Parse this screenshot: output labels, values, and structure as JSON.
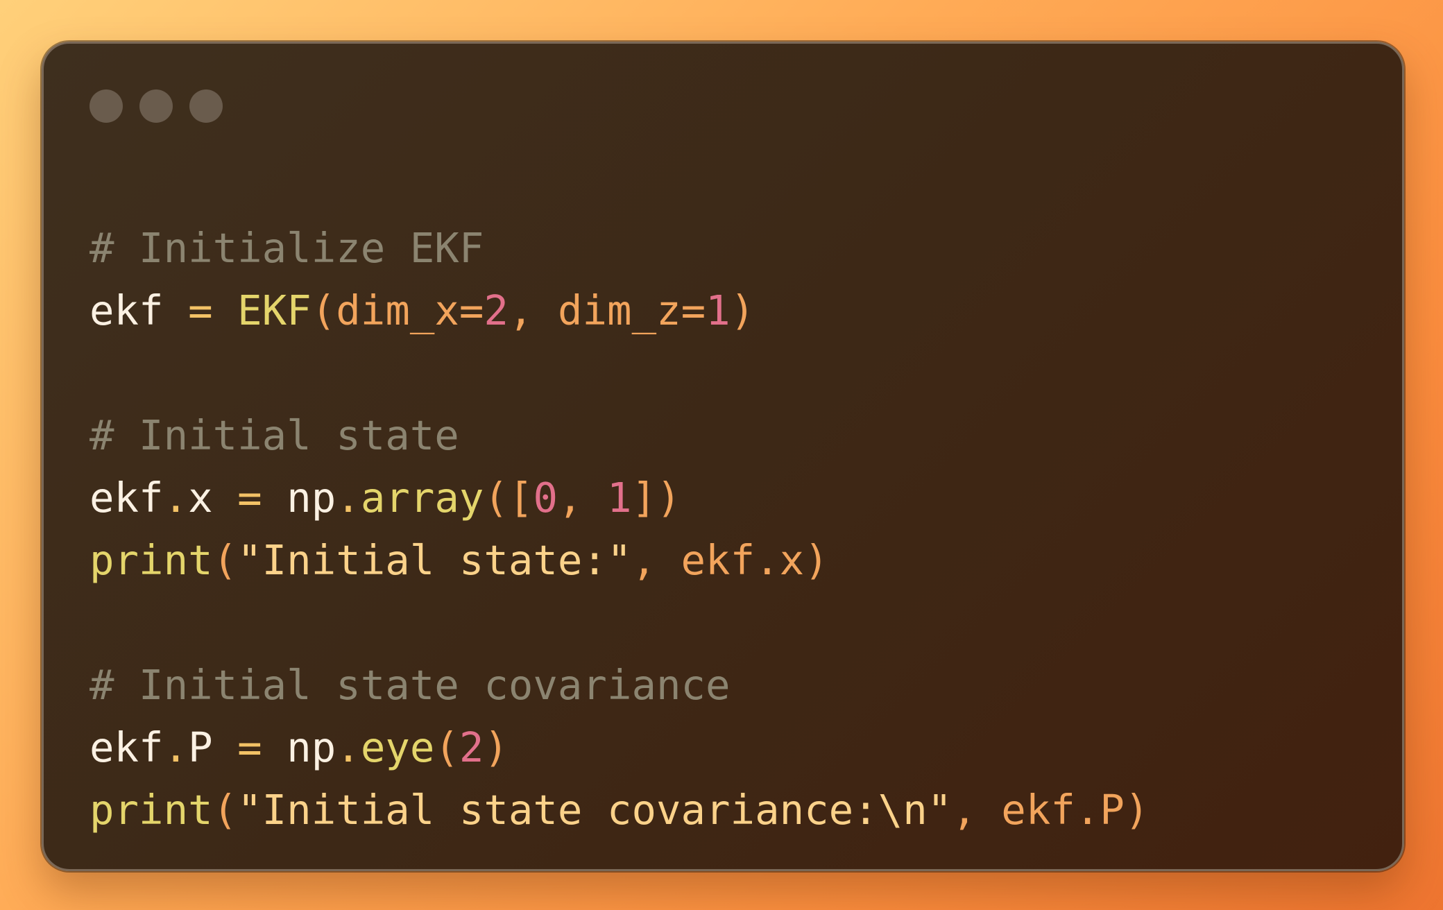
{
  "window": {
    "traffic_lights": [
      "dot",
      "dot",
      "dot"
    ]
  },
  "code_lines": [
    [
      {
        "t": "# Initialize EKF",
        "c": "com"
      }
    ],
    [
      {
        "t": "ekf",
        "c": "var"
      },
      {
        "t": " ",
        "c": "var"
      },
      {
        "t": "=",
        "c": "op"
      },
      {
        "t": " ",
        "c": "var"
      },
      {
        "t": "EKF",
        "c": "fn"
      },
      {
        "t": "(",
        "c": "par"
      },
      {
        "t": "dim_x",
        "c": "par"
      },
      {
        "t": "=",
        "c": "par"
      },
      {
        "t": "2",
        "c": "num"
      },
      {
        "t": ", ",
        "c": "par"
      },
      {
        "t": "dim_z",
        "c": "par"
      },
      {
        "t": "=",
        "c": "par"
      },
      {
        "t": "1",
        "c": "num"
      },
      {
        "t": ")",
        "c": "par"
      }
    ],
    [],
    [
      {
        "t": "# Initial state",
        "c": "com"
      }
    ],
    [
      {
        "t": "ekf",
        "c": "var"
      },
      {
        "t": ".",
        "c": "op"
      },
      {
        "t": "x",
        "c": "var"
      },
      {
        "t": " ",
        "c": "var"
      },
      {
        "t": "=",
        "c": "op"
      },
      {
        "t": " ",
        "c": "var"
      },
      {
        "t": "np",
        "c": "var"
      },
      {
        "t": ".",
        "c": "op"
      },
      {
        "t": "array",
        "c": "fn"
      },
      {
        "t": "([",
        "c": "par"
      },
      {
        "t": "0",
        "c": "num"
      },
      {
        "t": ", ",
        "c": "par"
      },
      {
        "t": "1",
        "c": "num"
      },
      {
        "t": "])",
        "c": "par"
      }
    ],
    [
      {
        "t": "print",
        "c": "fn"
      },
      {
        "t": "(",
        "c": "par"
      },
      {
        "t": "\"Initial state:\"",
        "c": "str"
      },
      {
        "t": ", ",
        "c": "par"
      },
      {
        "t": "ekf",
        "c": "par"
      },
      {
        "t": ".",
        "c": "par"
      },
      {
        "t": "x",
        "c": "par"
      },
      {
        "t": ")",
        "c": "par"
      }
    ],
    [],
    [
      {
        "t": "# Initial state covariance",
        "c": "com"
      }
    ],
    [
      {
        "t": "ekf",
        "c": "var"
      },
      {
        "t": ".",
        "c": "op"
      },
      {
        "t": "P",
        "c": "var"
      },
      {
        "t": " ",
        "c": "var"
      },
      {
        "t": "=",
        "c": "op"
      },
      {
        "t": " ",
        "c": "var"
      },
      {
        "t": "np",
        "c": "var"
      },
      {
        "t": ".",
        "c": "op"
      },
      {
        "t": "eye",
        "c": "fn"
      },
      {
        "t": "(",
        "c": "par"
      },
      {
        "t": "2",
        "c": "num"
      },
      {
        "t": ")",
        "c": "par"
      }
    ],
    [
      {
        "t": "print",
        "c": "fn"
      },
      {
        "t": "(",
        "c": "par"
      },
      {
        "t": "\"Initial state covariance:\\n\"",
        "c": "str"
      },
      {
        "t": ", ",
        "c": "par"
      },
      {
        "t": "ekf",
        "c": "par"
      },
      {
        "t": ".",
        "c": "par"
      },
      {
        "t": "P",
        "c": "par"
      },
      {
        "t": ")",
        "c": "par"
      }
    ]
  ],
  "colors": {
    "background_gradient": [
      "#ffd07a",
      "#ffab56",
      "#fb8d3e",
      "#ee7530"
    ],
    "window_background": "#3d2816",
    "window_border": "#7a6857",
    "traffic_light": "#6a5c4d",
    "comment": "#8b8470",
    "identifier": "#fbf1e3",
    "operator": "#f3c266",
    "function": "#e4d56b",
    "punctuation": "#f2a45c",
    "number": "#e2708b",
    "string": "#fbd28a"
  }
}
